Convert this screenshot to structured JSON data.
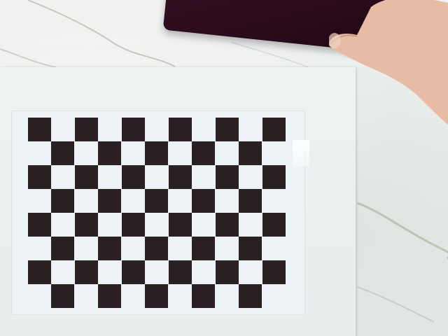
{
  "scene": {
    "background_color": "#e7ecea",
    "board_color": "#2a2021",
    "paper_color": "#edf2f6",
    "tablet_color": "#2b0b1c",
    "skin_color": "#e9c0a8"
  },
  "checkerboard": {
    "columns": 11,
    "rows": 8,
    "pattern": "alternating-dark-light"
  }
}
